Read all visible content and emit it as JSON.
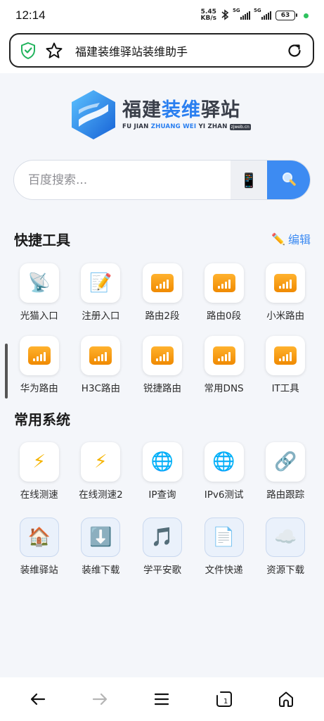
{
  "status": {
    "time": "12:14",
    "speed_value": "5.45",
    "speed_unit": "KB/s",
    "signal1_label": "5G",
    "signal2_label": "5G",
    "battery": "63"
  },
  "browser": {
    "page_title": "福建装维驿站装维助手"
  },
  "logo": {
    "cn_part1": "福建",
    "cn_part2": "装维",
    "cn_part3": "驿站",
    "en_part1": "FU JIAN",
    "en_part2": "ZHUANG WEI",
    "en_part3": "YI ZHAN",
    "tag": "zjweb.cn"
  },
  "search": {
    "placeholder": "百度搜索..."
  },
  "quick_tools": {
    "title": "快捷工具",
    "edit_label": "编辑",
    "items": [
      {
        "label": "光猫入口",
        "icon": "satellite-dish-icon"
      },
      {
        "label": "注册入口",
        "icon": "memo-icon"
      },
      {
        "label": "路由2段",
        "icon": "signal-bars-icon"
      },
      {
        "label": "路由0段",
        "icon": "signal-bars-icon"
      },
      {
        "label": "小米路由",
        "icon": "signal-bars-icon"
      },
      {
        "label": "华为路由",
        "icon": "signal-bars-icon"
      },
      {
        "label": "H3C路由",
        "icon": "signal-bars-icon"
      },
      {
        "label": "锐捷路由",
        "icon": "signal-bars-icon"
      },
      {
        "label": "常用DNS",
        "icon": "signal-bars-icon"
      },
      {
        "label": "IT工具",
        "icon": "signal-bars-icon"
      }
    ]
  },
  "common_systems": {
    "title": "常用系统",
    "items": [
      {
        "label": "在线测速",
        "icon": "lightning-icon"
      },
      {
        "label": "在线测速2",
        "icon": "lightning-icon"
      },
      {
        "label": "IP查询",
        "icon": "globe-icon"
      },
      {
        "label": "IPv6测试",
        "icon": "globe-icon"
      },
      {
        "label": "路由跟踪",
        "icon": "link-icon"
      },
      {
        "label": "装维驿站",
        "icon": "house-icon"
      },
      {
        "label": "装维下载",
        "icon": "download-arrow-icon"
      },
      {
        "label": "学平安歌",
        "icon": "music-note-icon"
      },
      {
        "label": "文件快递",
        "icon": "document-icon"
      },
      {
        "label": "资源下载",
        "icon": "cloud-icon"
      }
    ]
  },
  "colors": {
    "accent": "#3d8bf2",
    "orange": "#f59a0c"
  }
}
